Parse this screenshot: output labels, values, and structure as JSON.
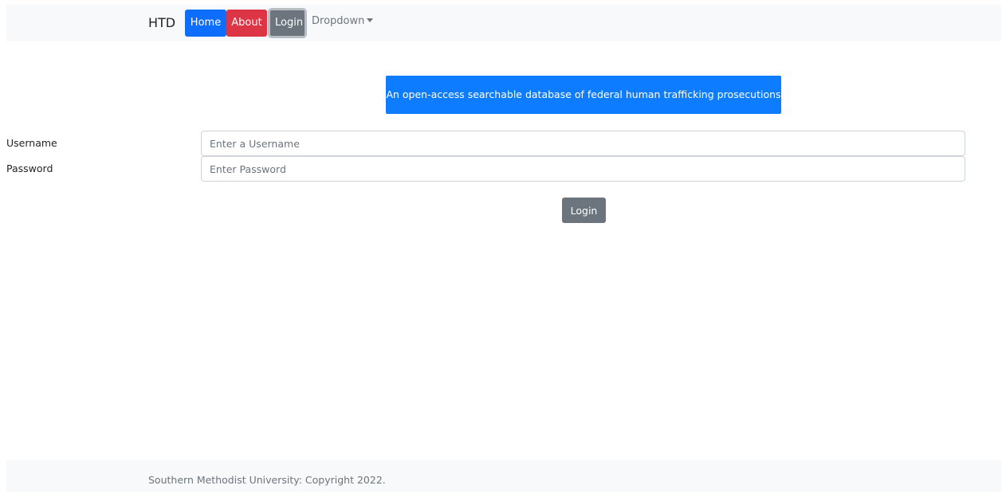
{
  "navbar": {
    "brand": "HTD",
    "items": [
      {
        "label": "Home",
        "color": "#0d6efd"
      },
      {
        "label": "About",
        "color": "#dc3545"
      },
      {
        "label": "Login",
        "color": "#6c757d"
      }
    ],
    "dropdown_label": "Dropdown"
  },
  "banner": {
    "text": "An open-access searchable database of federal human trafficking prosecutions",
    "color": "#0d7cff"
  },
  "form": {
    "username_label": "Username",
    "username_placeholder": "Enter a Username",
    "username_value": "",
    "password_label": "Password",
    "password_placeholder": "Enter Password",
    "password_value": "",
    "submit_label": "Login"
  },
  "footer": {
    "text": "Southern Methodist University: Copyright 2022."
  }
}
